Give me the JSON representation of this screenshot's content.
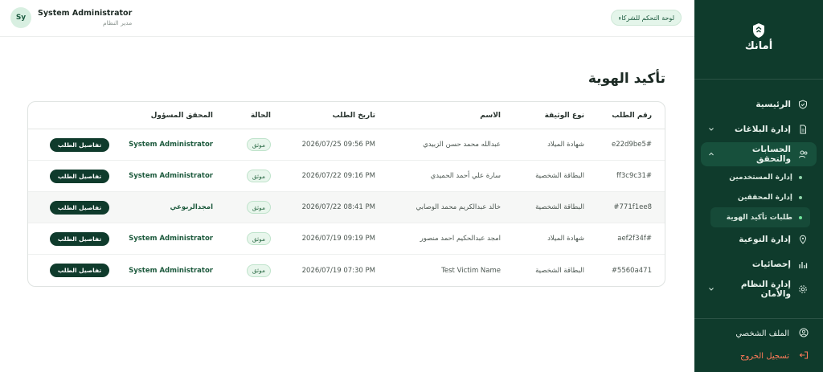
{
  "header": {
    "user_initials": "Sy",
    "user_name": "System Administrator",
    "user_role": "مدير النظام",
    "partner_button": "لوحة التحكم للشركاء"
  },
  "sidebar": {
    "brand": "أمانك",
    "nav": [
      {
        "label": "الرئيسية",
        "icon": "shield-check-icon"
      },
      {
        "label": "إدارة البلاغات",
        "icon": "document-icon"
      },
      {
        "label": "الحسابات والتحقق",
        "icon": "users-icon"
      },
      {
        "label": "إدارة التوعية",
        "icon": "pin-icon"
      },
      {
        "label": "إحصائيات",
        "icon": "bar-chart-icon"
      },
      {
        "label": "إدارة النظام والأمان",
        "icon": "gear-icon"
      }
    ],
    "sub_items": [
      {
        "label": "إدارة المستخدمين"
      },
      {
        "label": "إدارة المحققين"
      },
      {
        "label": "طلبات تأكيد الهوية"
      }
    ],
    "profile": "الملف الشخصي",
    "logout": "تسجيل الخروج"
  },
  "page": {
    "title": "تأكيد الهوية"
  },
  "table": {
    "headers": {
      "request_no": "رقم الطلب",
      "doc_type": "نوع الوثيقة",
      "name": "الاسم",
      "date": "تاريخ الطلب",
      "status": "الحالة",
      "verifier": "المحقق المسؤول"
    },
    "rows": [
      {
        "request_no": "e22d9be5#",
        "doc_type": "شهادة الميلاد",
        "name": "عبدالله محمد حسن الزبيدي",
        "date": "2026/07/25 09:56 PM",
        "status": "موثق",
        "verifier": "System Administrator",
        "action": "تفاصيل الطلب"
      },
      {
        "request_no": "ff3c9c31#",
        "doc_type": "البطاقة الشخصية",
        "name": "سارة علي أحمد الحميدي",
        "date": "2026/07/22 09:16 PM",
        "status": "موثق",
        "verifier": "System Administrator",
        "action": "تفاصيل الطلب"
      },
      {
        "request_no": "#771f1ee8",
        "doc_type": "البطاقة الشخصية",
        "name": "خالد عبدالكريم محمد الوصابي",
        "date": "2026/07/22 08:41 PM",
        "status": "موثق",
        "verifier": "امجدالربوعي",
        "action": "تفاصيل الطلب"
      },
      {
        "request_no": "aef2f34f#",
        "doc_type": "شهادة الميلاد",
        "name": "امجد عبدالحكيم احمد منصور",
        "date": "2026/07/19 09:19 PM",
        "status": "موثق",
        "verifier": "System Administrator",
        "action": "تفاصيل الطلب"
      },
      {
        "request_no": "#5560a471",
        "doc_type": "البطاقة الشخصية",
        "name": "Test Victim Name",
        "date": "2026/07/19 07:30 PM",
        "status": "موثق",
        "verifier": "System Administrator",
        "action": "تفاصيل الطلب"
      }
    ]
  },
  "colors": {
    "sidebar_bg": "#0f3b2c",
    "accent": "#1d5a3d",
    "logout": "#ff7a59"
  }
}
